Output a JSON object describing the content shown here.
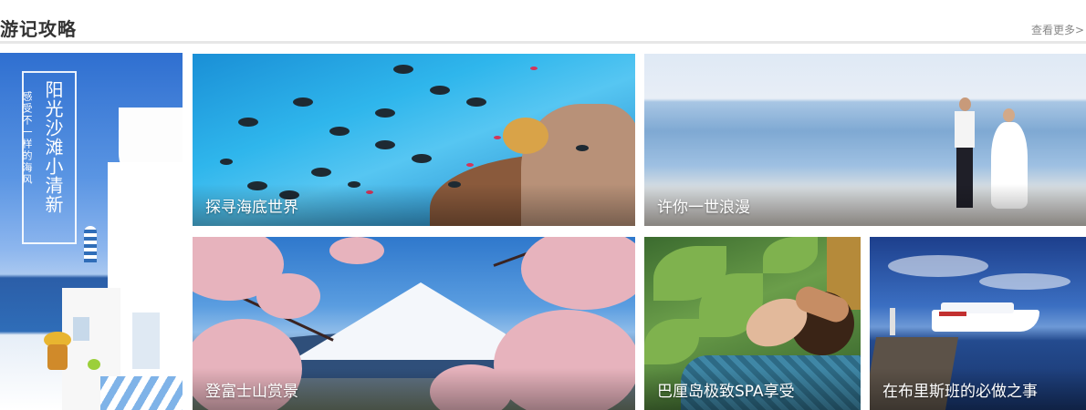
{
  "section": {
    "title": "游记攻略",
    "more_label": "查看更多>"
  },
  "feature": {
    "title": "阳光沙滩小清新",
    "subtitle": "感受不一样的海风"
  },
  "tiles": [
    {
      "label": "探寻海底世界"
    },
    {
      "label": "许你一世浪漫"
    },
    {
      "label": "登富士山赏景"
    },
    {
      "label": "巴厘岛极致SPA享受"
    },
    {
      "label": "在布里斯班的必做之事"
    }
  ]
}
